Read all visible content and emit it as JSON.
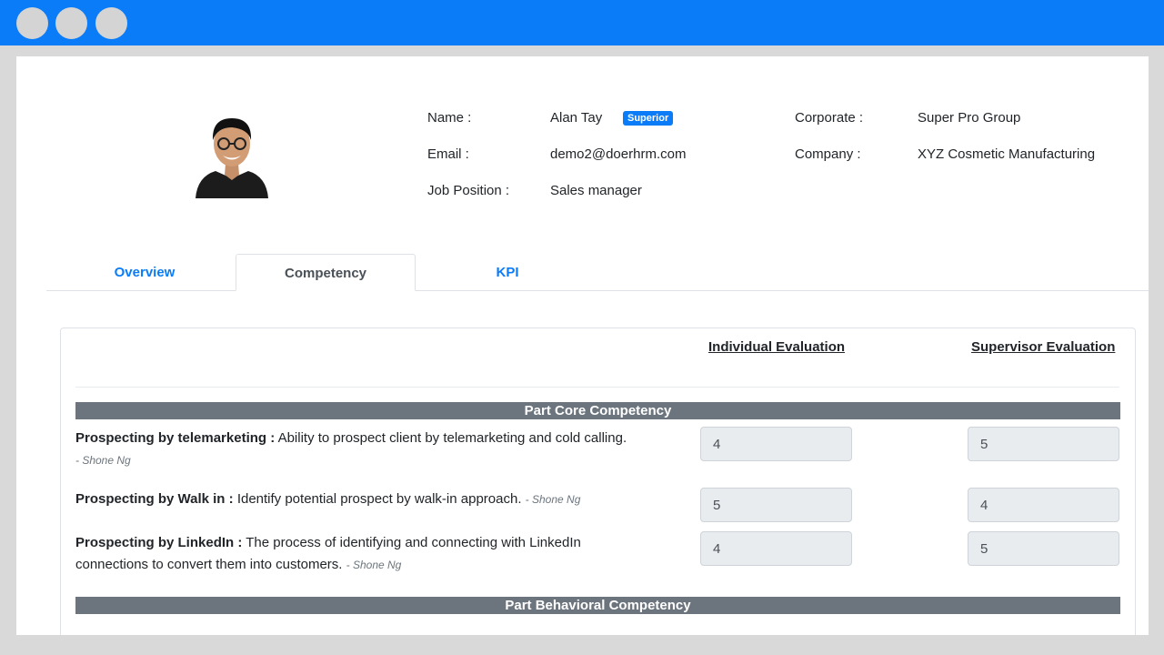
{
  "profile": {
    "name_label": "Name :",
    "name_value": "Alan Tay",
    "role_badge": "Superior",
    "email_label": "Email :",
    "email_value": "demo2@doerhrm.com",
    "job_label": "Job Position :",
    "job_value": "Sales manager",
    "corporate_label": "Corporate :",
    "corporate_value": "Super Pro Group",
    "company_label": "Company :",
    "company_value": "XYZ Cosmetic Manufacturing"
  },
  "tabs": [
    {
      "label": "Overview",
      "active": false
    },
    {
      "label": "Competency",
      "active": true
    },
    {
      "label": "KPI",
      "active": false
    }
  ],
  "evaluation": {
    "individual_header": "Individual Evaluation",
    "supervisor_header": "Supervisor Evaluation",
    "sections": [
      {
        "title": "Part Core Competency",
        "items": [
          {
            "name": "Prospecting by telemarketing :",
            "description": "Ability to prospect client by telemarketing and cold calling.",
            "author": "- Shone Ng",
            "individual": "4",
            "supervisor": "5"
          },
          {
            "name": "Prospecting by Walk in :",
            "description": "Identify potential prospect by walk-in approach.",
            "author": "- Shone Ng",
            "individual": "5",
            "supervisor": "4"
          },
          {
            "name": "Prospecting by LinkedIn :",
            "description": "The process of identifying and connecting with LinkedIn connections to convert them into customers.",
            "author": "- Shone Ng",
            "individual": "4",
            "supervisor": "5"
          }
        ]
      },
      {
        "title": "Part Behavioral Competency",
        "items": []
      }
    ]
  },
  "colors": {
    "accent": "#0a7cf8",
    "section_bar": "#6c757d",
    "input_bg": "#e9ecef"
  }
}
